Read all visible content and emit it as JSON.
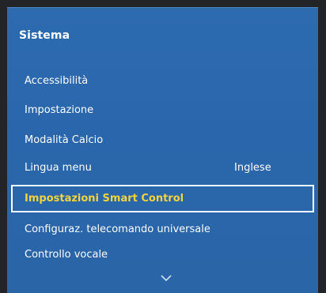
{
  "menu": {
    "title": "Sistema",
    "items": [
      {
        "label": "Accessibilità",
        "value": ""
      },
      {
        "label": "Impostazione",
        "value": ""
      },
      {
        "label": "Modalità Calcio",
        "value": ""
      },
      {
        "label": "Lingua menu",
        "value": "Inglese"
      },
      {
        "label": "Impostazioni Smart Control",
        "value": "",
        "selected": true
      },
      {
        "label": "Configuraz. telecomando universale",
        "value": ""
      },
      {
        "label": "Controllo vocale",
        "value": ""
      }
    ],
    "scroll_icon": "chevron-down-icon"
  },
  "colors": {
    "panel": "#2d6bb1",
    "selected_text": "#f2d43d",
    "text": "#ffffff",
    "frame": "#222428"
  }
}
